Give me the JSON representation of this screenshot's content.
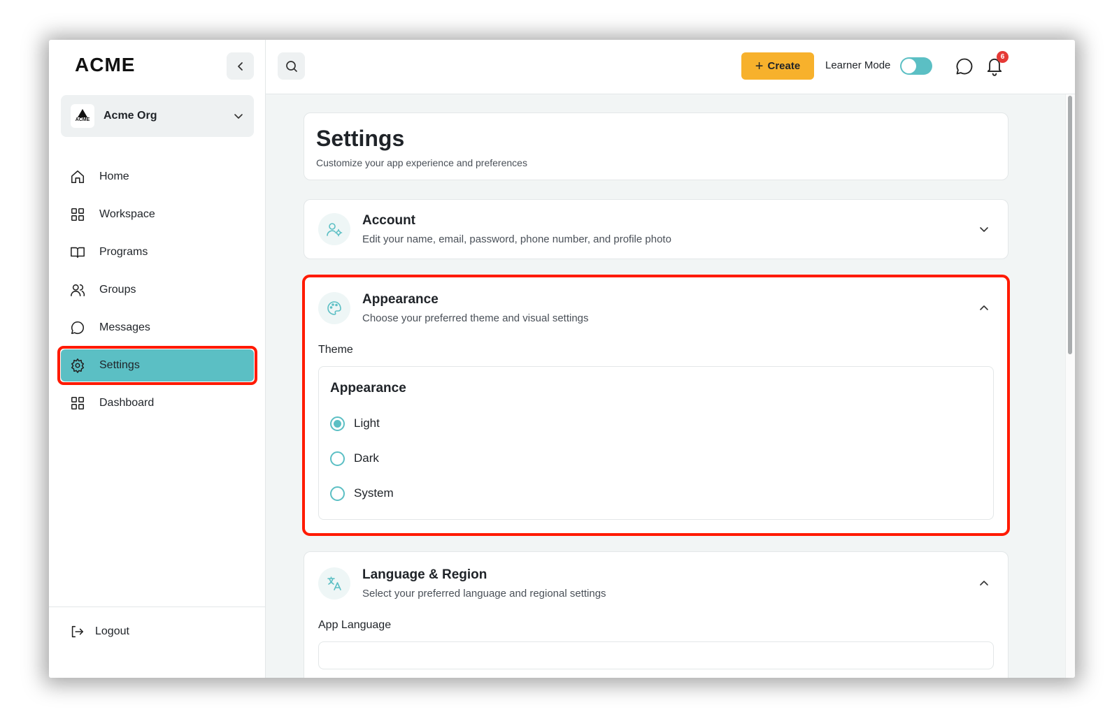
{
  "brand": {
    "logo": "ACME"
  },
  "org": {
    "name": "Acme Org",
    "logo_text": "ACME"
  },
  "sidebar": {
    "items": [
      {
        "label": "Home",
        "icon": "home-icon"
      },
      {
        "label": "Workspace",
        "icon": "grid-icon"
      },
      {
        "label": "Programs",
        "icon": "book-icon"
      },
      {
        "label": "Groups",
        "icon": "users-icon"
      },
      {
        "label": "Messages",
        "icon": "chat-icon"
      },
      {
        "label": "Settings",
        "icon": "gear-icon",
        "active": true
      },
      {
        "label": "Dashboard",
        "icon": "grid-icon"
      }
    ],
    "logout_label": "Logout"
  },
  "topbar": {
    "create_label": "Create",
    "learner_mode_label": "Learner Mode",
    "learner_mode_on": true,
    "notification_count": "6"
  },
  "page": {
    "title": "Settings",
    "subtitle": "Customize your app experience and preferences"
  },
  "sections": {
    "account": {
      "title": "Account",
      "desc": "Edit your name, email, password, phone number, and profile photo"
    },
    "appearance": {
      "title": "Appearance",
      "desc": "Choose your preferred theme and visual settings",
      "theme_label": "Theme",
      "box_title": "Appearance",
      "options": [
        "Light",
        "Dark",
        "System"
      ],
      "selected": "Light"
    },
    "language": {
      "title": "Language & Region",
      "desc": "Select your preferred language and regional settings",
      "app_language_label": "App Language"
    }
  },
  "colors": {
    "accent": "#5bbfc4",
    "create": "#f7b12c",
    "highlight": "#ff1a00",
    "badge": "#e53935"
  }
}
